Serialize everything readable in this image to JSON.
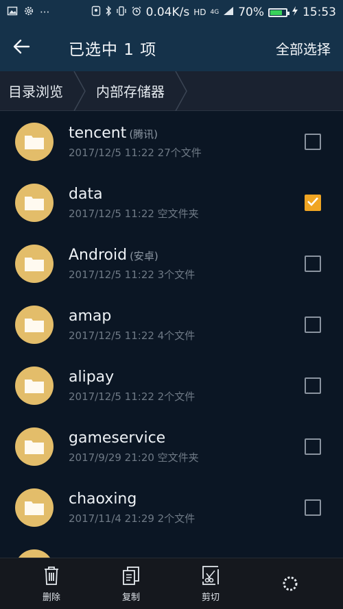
{
  "status": {
    "speed": "0.04K/s",
    "network": "HD",
    "signal_label": "4G",
    "battery_pct": "70%",
    "battery_level": 0.7,
    "time": "15:53"
  },
  "appbar": {
    "title": "已选中 1 项",
    "select_all": "全部选择"
  },
  "breadcrumb": [
    "目录浏览",
    "内部存储器"
  ],
  "files": [
    {
      "name": "tencent",
      "tag": "(腾讯)",
      "meta": "2017/12/5 11:22 27个文件",
      "checked": false
    },
    {
      "name": "data",
      "tag": "",
      "meta": "2017/12/5 11:22 空文件夹",
      "checked": true
    },
    {
      "name": "Android",
      "tag": "(安卓)",
      "meta": "2017/12/5 11:22 3个文件",
      "checked": false
    },
    {
      "name": "amap",
      "tag": "",
      "meta": "2017/12/5 11:22 4个文件",
      "checked": false
    },
    {
      "name": "alipay",
      "tag": "",
      "meta": "2017/12/5 11:22 2个文件",
      "checked": false
    },
    {
      "name": "gameservice",
      "tag": "",
      "meta": "2017/9/29 21:20 空文件夹",
      "checked": false
    },
    {
      "name": "chaoxing",
      "tag": "",
      "meta": "2017/11/4 21:29 2个文件",
      "checked": false
    }
  ],
  "bottombar": {
    "delete": "删除",
    "copy": "复制",
    "cut": "剪切"
  },
  "colors": {
    "accent": "#f0a523",
    "folder": "#e3bd6a",
    "appbar": "#15324a",
    "background": "#0b1624"
  }
}
